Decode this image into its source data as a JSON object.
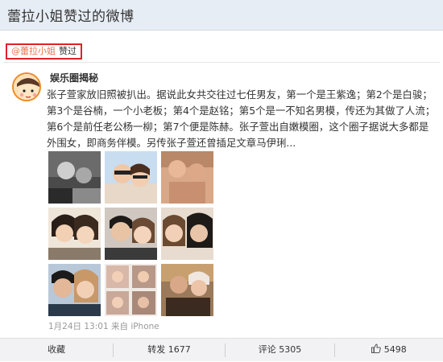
{
  "page": {
    "title": "蕾拉小姐赞过的微博"
  },
  "liked_tag": {
    "user": "@蕾拉小姐",
    "action": "赞过"
  },
  "post": {
    "author": "娱乐圈揭秘",
    "text": "张子萱家放旧照被扒出。据说此女共交往过七任男友，第一个是王紫逸；第2个是白骏；第3个是谷楠，一个小老板；第4个是赵铭；第5个是一不知名男模，传还为其做了人流；第6个是前任老公杨一柳；第7个便是陈赫。张子萱出自嫩模圈，这个圈子据说大多都是外围女，即商务伴模。另传张子萱还曾插足文章马伊琍...",
    "meta": "1月24日 13:01 来自 iPhone",
    "images": [
      "photo-1",
      "photo-2",
      "photo-3",
      "photo-4",
      "photo-5",
      "photo-6",
      "photo-7",
      "photo-8",
      "photo-9"
    ]
  },
  "actions": {
    "collect": "收藏",
    "repost": "转发 1677",
    "comment": "评论 5305",
    "like": "5498"
  },
  "colors": {
    "accent": "#eb7350",
    "highlight_border": "#e0202a",
    "title_bg": "#e7edf4"
  },
  "icons": [
    "avatar-cartoon-icon",
    "thumbs-up-icon"
  ]
}
